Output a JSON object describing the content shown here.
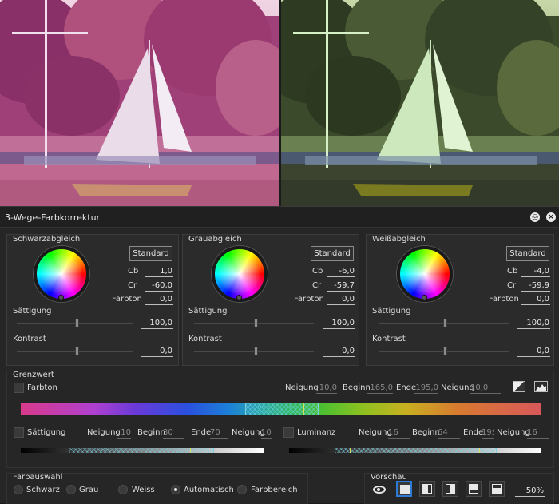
{
  "window": {
    "title": "3-Wege-Farbkorrektur"
  },
  "balance": [
    {
      "title": "Schwarzabgleich",
      "standard": "Standard",
      "cb_label": "Cb",
      "cb": "1,0",
      "cr_label": "Cr",
      "cr": "-60,0",
      "farbton_label": "Farbton",
      "farbton": "0,0",
      "saettigung_label": "Sättigung",
      "saettigung": "100,0",
      "kontrast_label": "Kontrast",
      "kontrast": "0,0"
    },
    {
      "title": "Grauabgleich",
      "standard": "Standard",
      "cb_label": "Cb",
      "cb": "-6,0",
      "cr_label": "Cr",
      "cr": "-59,7",
      "farbton_label": "Farbton",
      "farbton": "0,0",
      "saettigung_label": "Sättigung",
      "saettigung": "100,0",
      "kontrast_label": "Kontrast",
      "kontrast": "0,0"
    },
    {
      "title": "Weißabgleich",
      "standard": "Standard",
      "cb_label": "Cb",
      "cb": "-4,0",
      "cr_label": "Cr",
      "cr": "-59,9",
      "farbton_label": "Farbton",
      "farbton": "0,0",
      "saettigung_label": "Sättigung",
      "saettigung": "100,0",
      "kontrast_label": "Kontrast",
      "kontrast": "0,0"
    }
  ],
  "grenzwert": {
    "title": "Grenzwert",
    "farbton": {
      "label": "Farbton",
      "neigung_label": "Neigung",
      "neigung1": "10,0",
      "beginn_label": "Beginn",
      "beginn": "165,0",
      "ende_label": "Ende",
      "ende": "195,0",
      "neigung2": "10,0"
    },
    "saettigung": {
      "label": "Sättigung",
      "neigung_label": "Neigung",
      "neigung1": "10",
      "beginn_label": "Beginn",
      "beginn": "30",
      "ende_label": "Ende",
      "ende": "70",
      "neigung2": "10"
    },
    "luminanz": {
      "label": "Luminanz",
      "neigung_label": "Neigung",
      "neigung1": "16",
      "beginn_label": "Beginn",
      "beginn": "64",
      "ende_label": "Ende",
      "ende": "19$",
      "neigung2": "16"
    }
  },
  "farbauswahl": {
    "title": "Farbauswahl",
    "options": [
      "Schwarz",
      "Grau",
      "Weiss",
      "Automatisch",
      "Farbbereich"
    ],
    "selected": "Automatisch"
  },
  "vorschau": {
    "title": "Vorschau",
    "zoom": "50%"
  },
  "icons": {
    "close": "close-icon",
    "settings": "settings-icon",
    "eye": "eye-icon"
  },
  "colors": {
    "accent": "#2e7bd6",
    "panel_bg": "#262626",
    "box_bg": "#2b2b2b"
  }
}
